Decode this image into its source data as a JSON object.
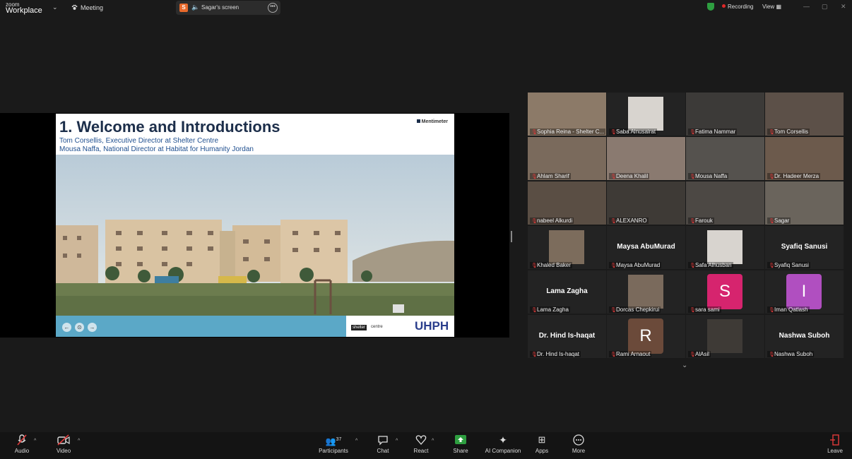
{
  "topbar": {
    "brand_line1": "zoom",
    "brand_line2": "Workplace",
    "meeting_label": "Meeting",
    "share_initial": "S",
    "share_label": "Sagar's screen",
    "recording_label": "Recording",
    "view_label": "View"
  },
  "slide": {
    "title": "1. Welcome and Introductions",
    "subtitle1": "Tom Corsellis, Executive Director at Shelter Centre",
    "subtitle2": "Mousa Naffa, National Director at Habitat for Humanity Jordan",
    "menti_label": "Mentimeter",
    "logo_shelter": "shelter",
    "logo_centre": "centre",
    "logo_uhph": "UHPH"
  },
  "gallery": {
    "tiles": [
      {
        "name": "Sophia Reina - Shelter C..."
      },
      {
        "name": "Saba Alnusairat"
      },
      {
        "name": "Fatima Nammar"
      },
      {
        "name": "Tom Corsellis"
      },
      {
        "name": "Ahlam Sharif"
      },
      {
        "name": "Deena Khalil"
      },
      {
        "name": "Mousa Naffa"
      },
      {
        "name": "Dr. Hadeer Merza"
      },
      {
        "name": "nabeel Alkurdi"
      },
      {
        "name": "ALEXANRO"
      },
      {
        "name": "Farouk"
      },
      {
        "name": "Sagar"
      },
      {
        "name": "Khaled Baker"
      },
      {
        "name": "Maysa AbuMurad",
        "big": "Maysa AbuMurad"
      },
      {
        "name": "Safa Alhusban"
      },
      {
        "name": "Syafiq Sanusi",
        "big": "Syafiq Sanusi"
      },
      {
        "name": "Lama Zagha",
        "big": "Lama Zagha"
      },
      {
        "name": "Dorcas Chepkirui"
      },
      {
        "name": "sara sami",
        "letter": "S"
      },
      {
        "name": "Iman Qatlash",
        "letter": "I"
      },
      {
        "name": "Dr. Hind Is-haqat",
        "big": "Dr. Hind Is-haqat"
      },
      {
        "name": "Rami Arnaout",
        "letter": "R"
      },
      {
        "name": "AlAsil"
      },
      {
        "name": "Nashwa Suboh",
        "big": "Nashwa Suboh"
      }
    ]
  },
  "toolbar": {
    "audio": "Audio",
    "video": "Video",
    "participants": "Participants",
    "participants_count": "37",
    "chat": "Chat",
    "react": "React",
    "share": "Share",
    "ai": "AI Companion",
    "apps": "Apps",
    "more": "More",
    "leave": "Leave"
  },
  "colors": {
    "accent_green": "#3bc06a",
    "share_green": "#2e9e40",
    "record_red": "#e02828",
    "avatar_s": "#d6246e",
    "avatar_i": "#b04fc0",
    "avatar_r": "#6b4a3a"
  }
}
